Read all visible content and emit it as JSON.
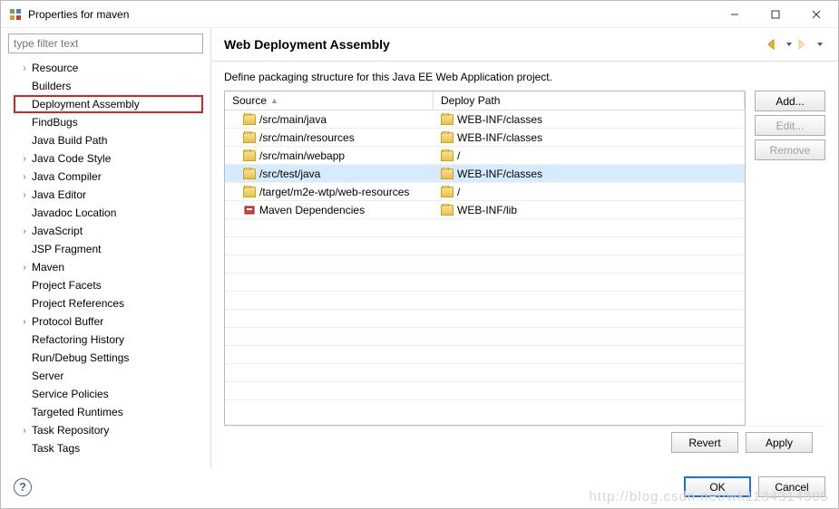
{
  "window": {
    "title": "Properties for maven"
  },
  "filter": {
    "placeholder": "type filter text"
  },
  "sidebar": {
    "items": [
      {
        "label": "Resource",
        "expandable": true
      },
      {
        "label": "Builders",
        "expandable": false
      },
      {
        "label": "Deployment Assembly",
        "expandable": false,
        "selected": true
      },
      {
        "label": "FindBugs",
        "expandable": false
      },
      {
        "label": "Java Build Path",
        "expandable": false
      },
      {
        "label": "Java Code Style",
        "expandable": true
      },
      {
        "label": "Java Compiler",
        "expandable": true
      },
      {
        "label": "Java Editor",
        "expandable": true
      },
      {
        "label": "Javadoc Location",
        "expandable": false
      },
      {
        "label": "JavaScript",
        "expandable": true
      },
      {
        "label": "JSP Fragment",
        "expandable": false
      },
      {
        "label": "Maven",
        "expandable": true
      },
      {
        "label": "Project Facets",
        "expandable": false
      },
      {
        "label": "Project References",
        "expandable": false
      },
      {
        "label": "Protocol Buffer",
        "expandable": true
      },
      {
        "label": "Refactoring History",
        "expandable": false
      },
      {
        "label": "Run/Debug Settings",
        "expandable": false
      },
      {
        "label": "Server",
        "expandable": false
      },
      {
        "label": "Service Policies",
        "expandable": false
      },
      {
        "label": "Targeted Runtimes",
        "expandable": false
      },
      {
        "label": "Task Repository",
        "expandable": true
      },
      {
        "label": "Task Tags",
        "expandable": false
      }
    ]
  },
  "header": {
    "title": "Web Deployment Assembly"
  },
  "description": "Define packaging structure for this Java EE Web Application project.",
  "table": {
    "columns": {
      "source": "Source",
      "deploy": "Deploy Path"
    },
    "rows": [
      {
        "icon": "folder",
        "source": "/src/main/java",
        "deploy": "WEB-INF/classes"
      },
      {
        "icon": "folder",
        "source": "/src/main/resources",
        "deploy": "WEB-INF/classes"
      },
      {
        "icon": "folder",
        "source": "/src/main/webapp",
        "deploy": "/"
      },
      {
        "icon": "folder",
        "source": "/src/test/java",
        "deploy": "WEB-INF/classes",
        "selected": true
      },
      {
        "icon": "folder",
        "source": "/target/m2e-wtp/web-resources",
        "deploy": "/"
      },
      {
        "icon": "maven",
        "source": "Maven Dependencies",
        "deploy": "WEB-INF/lib"
      }
    ]
  },
  "buttons": {
    "add": "Add...",
    "edit": "Edit...",
    "remove": "Remove",
    "revert": "Revert",
    "apply": "Apply",
    "ok": "OK",
    "cancel": "Cancel"
  },
  "watermark": "http://blog.csdn.net/wk1134314305"
}
